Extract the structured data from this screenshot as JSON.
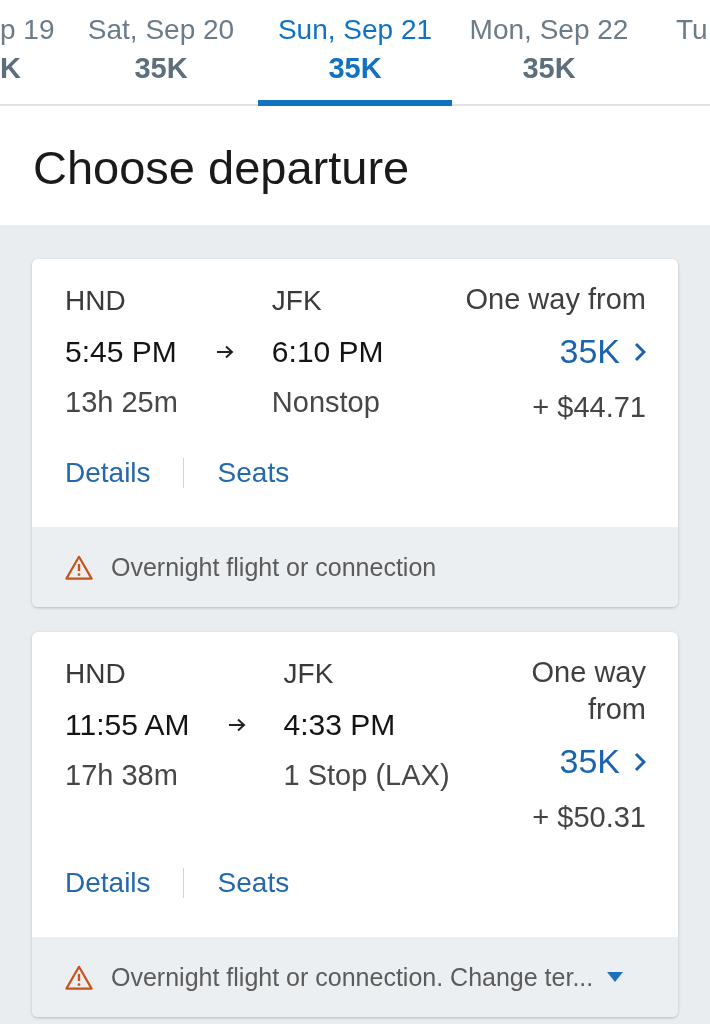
{
  "date_tabs": [
    {
      "date": "p 19",
      "price": "K",
      "selected": false
    },
    {
      "date": "Sat, Sep 20",
      "price": "35K",
      "selected": false
    },
    {
      "date": "Sun, Sep 21",
      "price": "35K",
      "selected": true
    },
    {
      "date": "Mon, Sep 22",
      "price": "35K",
      "selected": false
    },
    {
      "date": "Tu",
      "selected": false
    }
  ],
  "heading": "Choose departure",
  "flights": [
    {
      "origin": "HND",
      "destination": "JFK",
      "depart_time": "5:45 PM",
      "arrive_time": "6:10 PM",
      "duration": "13h 25m",
      "stops": "Nonstop",
      "fare_label": "One way from",
      "miles": "35K",
      "fee": "+ $44.71",
      "details_link": "Details",
      "seats_link": "Seats",
      "notice": {
        "text": "Overnight flight or connection"
      }
    },
    {
      "origin": "HND",
      "destination": "JFK",
      "depart_time": "11:55 AM",
      "arrive_time": "4:33 PM",
      "duration": "17h 38m",
      "stops": "1 Stop (LAX)",
      "fare_label": "One way from",
      "miles": "35K",
      "fee": "+ $50.31",
      "details_link": "Details",
      "seats_link": "Seats",
      "notice": {
        "text": "Overnight flight or connection. Change ter...",
        "expandable": true,
        "expanded": false
      }
    }
  ]
}
